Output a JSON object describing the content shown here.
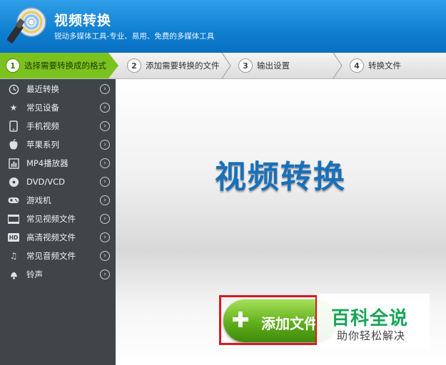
{
  "app": {
    "title": "视频转换",
    "subtitle": "锐动多媒体工具-专业、易用、免费的多媒体工具"
  },
  "steps": [
    {
      "num": "1",
      "label": "选择需要转换成的格式",
      "active": true
    },
    {
      "num": "2",
      "label": "添加需要转换的文件",
      "active": false
    },
    {
      "num": "3",
      "label": "输出设置",
      "active": false
    },
    {
      "num": "4",
      "label": "转换文件",
      "active": false
    }
  ],
  "sidebar": {
    "items": [
      {
        "label": "最近转换",
        "icon": "clock-icon"
      },
      {
        "label": "常见设备",
        "icon": "star-icon"
      },
      {
        "label": "手机视频",
        "icon": "phone-icon"
      },
      {
        "label": "苹果系列",
        "icon": "apple-icon"
      },
      {
        "label": "MP4播放器",
        "icon": "mp4-player-icon"
      },
      {
        "label": "DVD/VCD",
        "icon": "disc-icon"
      },
      {
        "label": "游戏机",
        "icon": "gamepad-icon"
      },
      {
        "label": "常见视频文件",
        "icon": "film-icon"
      },
      {
        "label": "高清视频文件",
        "icon": "hd-icon"
      },
      {
        "label": "常见音频文件",
        "icon": "music-note-icon"
      },
      {
        "label": "铃声",
        "icon": "bell-icon"
      }
    ]
  },
  "main": {
    "big_title": "视频转换",
    "add_button_label": "添加文件",
    "plus_symbol": "✚"
  },
  "watermark": {
    "title": "百科全说",
    "subtitle": "助你轻松解决"
  },
  "colors": {
    "header_blue": "#0f7fd0",
    "step_active_green": "#7bc21f",
    "sidebar_bg": "#3f4549",
    "title_blue": "#1a70b8",
    "highlight_red": "#d71920",
    "watermark_green": "#18a557"
  }
}
